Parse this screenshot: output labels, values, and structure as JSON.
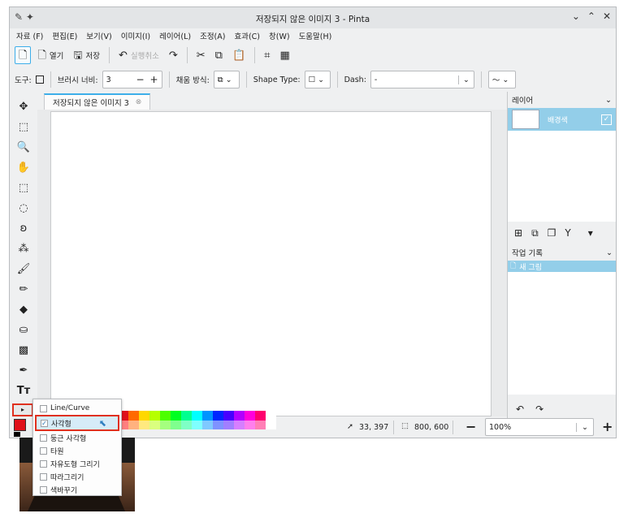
{
  "window": {
    "title": "저장되지 않은 이미지 3 - Pinta"
  },
  "menu": [
    "자료 (F)",
    "편집(E)",
    "보기(V)",
    "이미지(I)",
    "레이어(L)",
    "조정(A)",
    "효과(C)",
    "창(W)",
    "도움말(H)"
  ],
  "toolbar": {
    "open_label": "열기",
    "save_label": "저장",
    "undo_label": "실행취소"
  },
  "options": {
    "tool_label": "도구:",
    "brush_width_label": "브러시 너비:",
    "brush_width_value": "3",
    "fill_label": "채움 방식:",
    "shape_type_label": "Shape Type:",
    "dash_label": "Dash:",
    "dash_value": "-"
  },
  "tab": {
    "label": "저장되지 않은 이미지 3"
  },
  "layers": {
    "title": "레이어",
    "items": [
      {
        "name": "배경색"
      }
    ]
  },
  "history": {
    "title": "작업 기록",
    "items": [
      {
        "label": "새 그림"
      }
    ]
  },
  "status": {
    "cursor": "33, 397",
    "selection_size": "800, 600",
    "zoom": "100%"
  },
  "shape_menu": {
    "items": [
      {
        "label": "Line/Curve",
        "checked": false
      },
      {
        "label": "사각형",
        "checked": true
      },
      {
        "label": "둥근 사각형",
        "checked": false
      },
      {
        "label": "타원",
        "checked": false
      },
      {
        "label": "자유도형 그리기",
        "checked": false
      },
      {
        "label": "따라그리기",
        "checked": false
      },
      {
        "label": "색바꾸기",
        "checked": false
      }
    ]
  },
  "colors": {
    "primary": "#e0101a",
    "secondary": "#000000",
    "accent": "#3daee9",
    "highlight": "#93cee9",
    "annotation": "#e0301e"
  },
  "palette": {
    "top": [
      "#e0101a",
      "#ff6a00",
      "#ffd800",
      "#b6ff00",
      "#4cff00",
      "#00ff21",
      "#00ff90",
      "#00ffff",
      "#0094ff",
      "#0026ff",
      "#4800ff",
      "#b200ff",
      "#ff00dc",
      "#ff006e",
      "#ffffff"
    ],
    "bottom": [
      "#ff7f7f",
      "#ffb27f",
      "#ffe97f",
      "#daff7f",
      "#a5ff7f",
      "#7fff8e",
      "#7fffc5",
      "#7fffff",
      "#7fc9ff",
      "#7f92ff",
      "#a17fff",
      "#d67fff",
      "#ff7fed",
      "#ff7fb6",
      "#ffffff"
    ]
  }
}
